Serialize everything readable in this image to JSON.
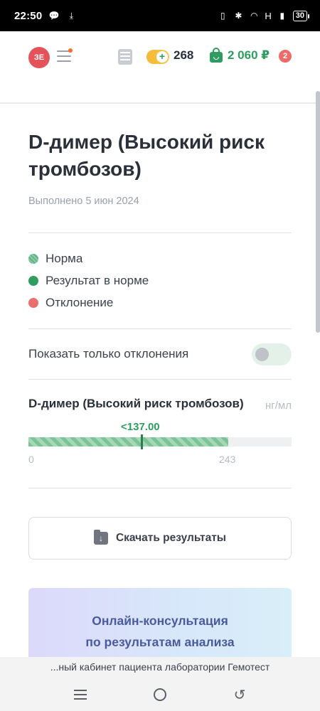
{
  "status_bar": {
    "time": "22:50",
    "network": "H",
    "battery": "30"
  },
  "header": {
    "avatar_initials": "ЗЕ",
    "coins": "268",
    "balance": "2 060 ₽",
    "cart_count": "2"
  },
  "test": {
    "title": "D-димер (Высокий риск тромбозов)",
    "completed": "Выполнено 5 июн 2024"
  },
  "legend": {
    "items": [
      {
        "label": "Норма",
        "color": "#6fbc8e"
      },
      {
        "label": "Результат в норме",
        "color": "#2e9d5f"
      },
      {
        "label": "Отклонение",
        "color": "#ea6f6f"
      }
    ]
  },
  "filter": {
    "deviations_only_label": "Показать только отклонения",
    "deviations_only": false
  },
  "result": {
    "name": "D-димер (Высокий риск тромбозов)",
    "unit": "нг/мл",
    "value_label": "<137.00",
    "value": 137.0,
    "range_min": "0",
    "range_max": "243",
    "scale_max": 320
  },
  "actions": {
    "download_label": "Скачать результаты"
  },
  "consultation": {
    "line1": "Онлайн-консультация",
    "line2": "по результатам анализа"
  },
  "browser": {
    "page_title": "...ный кабинет пациента лаборатории Гемотест"
  },
  "icons": {
    "download": "download-folder-icon",
    "wallet": "wallet-bag-icon",
    "coins": "coins-plus-icon",
    "orders": "list-icon"
  }
}
